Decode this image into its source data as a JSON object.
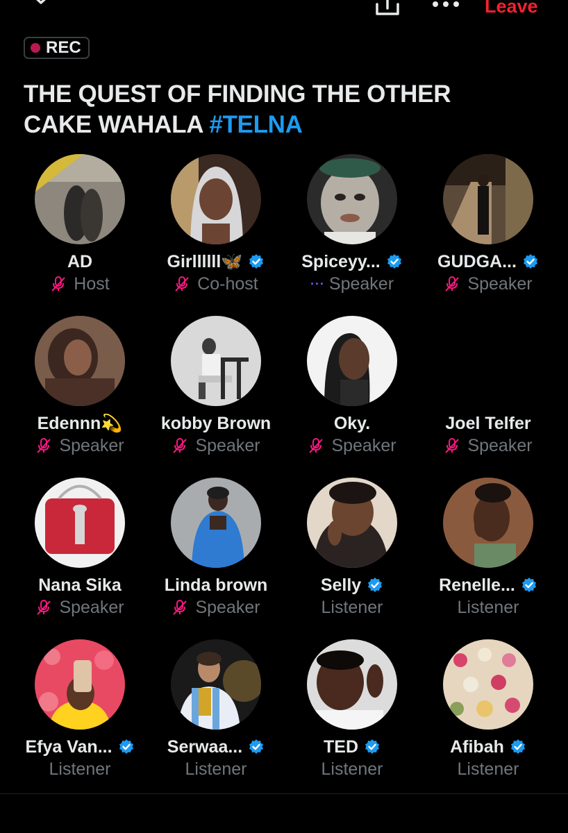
{
  "header": {
    "leave_label": "Leave",
    "icons": [
      "chevron-down-icon",
      "share-icon",
      "more-icon"
    ]
  },
  "rec_badge": {
    "label": "REC",
    "color": "#b8194f"
  },
  "space": {
    "title_line1": "THE QUEST OF FINDING THE OTHER",
    "title_line2_text": "CAKE WAHALA ",
    "title_hashtag": "#TELNA",
    "hashtag_color": "#1d9bf0"
  },
  "participants": [
    {
      "name": "AD",
      "role": "Host",
      "verified": false,
      "mic": "muted"
    },
    {
      "name": "Girllllll🦋",
      "role": "Co-host",
      "verified": true,
      "mic": "muted"
    },
    {
      "name": "Spiceyy...",
      "role": "Speaker",
      "verified": true,
      "mic": "speaking"
    },
    {
      "name": "GUDGA...",
      "role": "Speaker",
      "verified": true,
      "mic": "muted"
    },
    {
      "name": "Edennn💫",
      "role": "Speaker",
      "verified": false,
      "mic": "muted"
    },
    {
      "name": "kobby Brown",
      "role": "Speaker",
      "verified": false,
      "mic": "muted"
    },
    {
      "name": "Oky.",
      "role": "Speaker",
      "verified": false,
      "mic": "muted"
    },
    {
      "name": "Joel Telfer",
      "role": "Speaker",
      "verified": false,
      "mic": "muted"
    },
    {
      "name": "Nana Sika",
      "role": "Speaker",
      "verified": false,
      "mic": "muted"
    },
    {
      "name": "Linda brown",
      "role": "Speaker",
      "verified": false,
      "mic": "muted"
    },
    {
      "name": "Selly",
      "role": "Listener",
      "verified": true,
      "mic": "none"
    },
    {
      "name": "Renelle...",
      "role": "Listener",
      "verified": true,
      "mic": "none"
    },
    {
      "name": "Efya Van...",
      "role": "Listener",
      "verified": true,
      "mic": "none"
    },
    {
      "name": "Serwaa...",
      "role": "Listener",
      "verified": true,
      "mic": "none"
    },
    {
      "name": "TED",
      "role": "Listener",
      "verified": true,
      "mic": "none"
    },
    {
      "name": "Afibah",
      "role": "Listener",
      "verified": true,
      "mic": "none"
    }
  ],
  "colors": {
    "background": "#000000",
    "text": "#e7e9ea",
    "muted_text": "#71767b",
    "verified": "#1d9bf0",
    "mic_off": "#f91880",
    "leave": "#f4212e"
  }
}
